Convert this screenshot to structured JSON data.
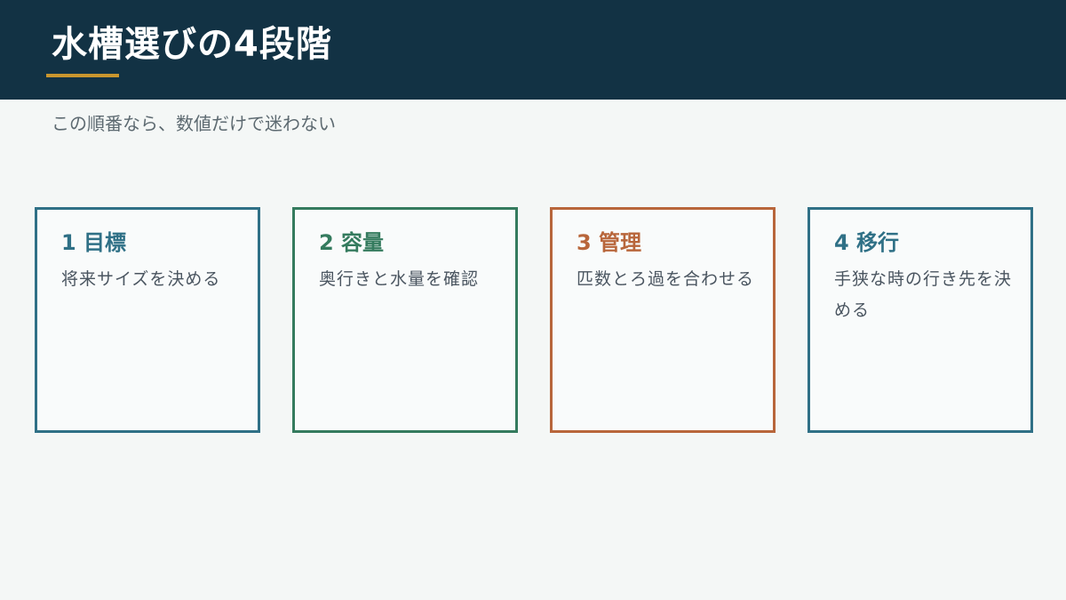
{
  "slide": {
    "title": "水槽選びの4段階",
    "subtitle": "この順番なら、数値だけで迷わない"
  },
  "colors": {
    "header_background": "#123244",
    "accent_underline": "#c9962e",
    "page_background": "#f4f7f6",
    "card_1": "#2f7086",
    "card_2": "#347b5e",
    "card_3": "#b8663b",
    "card_4": "#2f7086"
  },
  "cards": [
    {
      "title": "1 目標",
      "text": "将来サイズを決める",
      "color": "#2f7086"
    },
    {
      "title": "2 容量",
      "text": "奥行きと水量を確認",
      "color": "#347b5e"
    },
    {
      "title": "3 管理",
      "text": "匹数とろ過を合わせる",
      "color": "#b8663b"
    },
    {
      "title": "4 移行",
      "text": "手狭な時の行き先を決める",
      "color": "#2f7086"
    }
  ]
}
